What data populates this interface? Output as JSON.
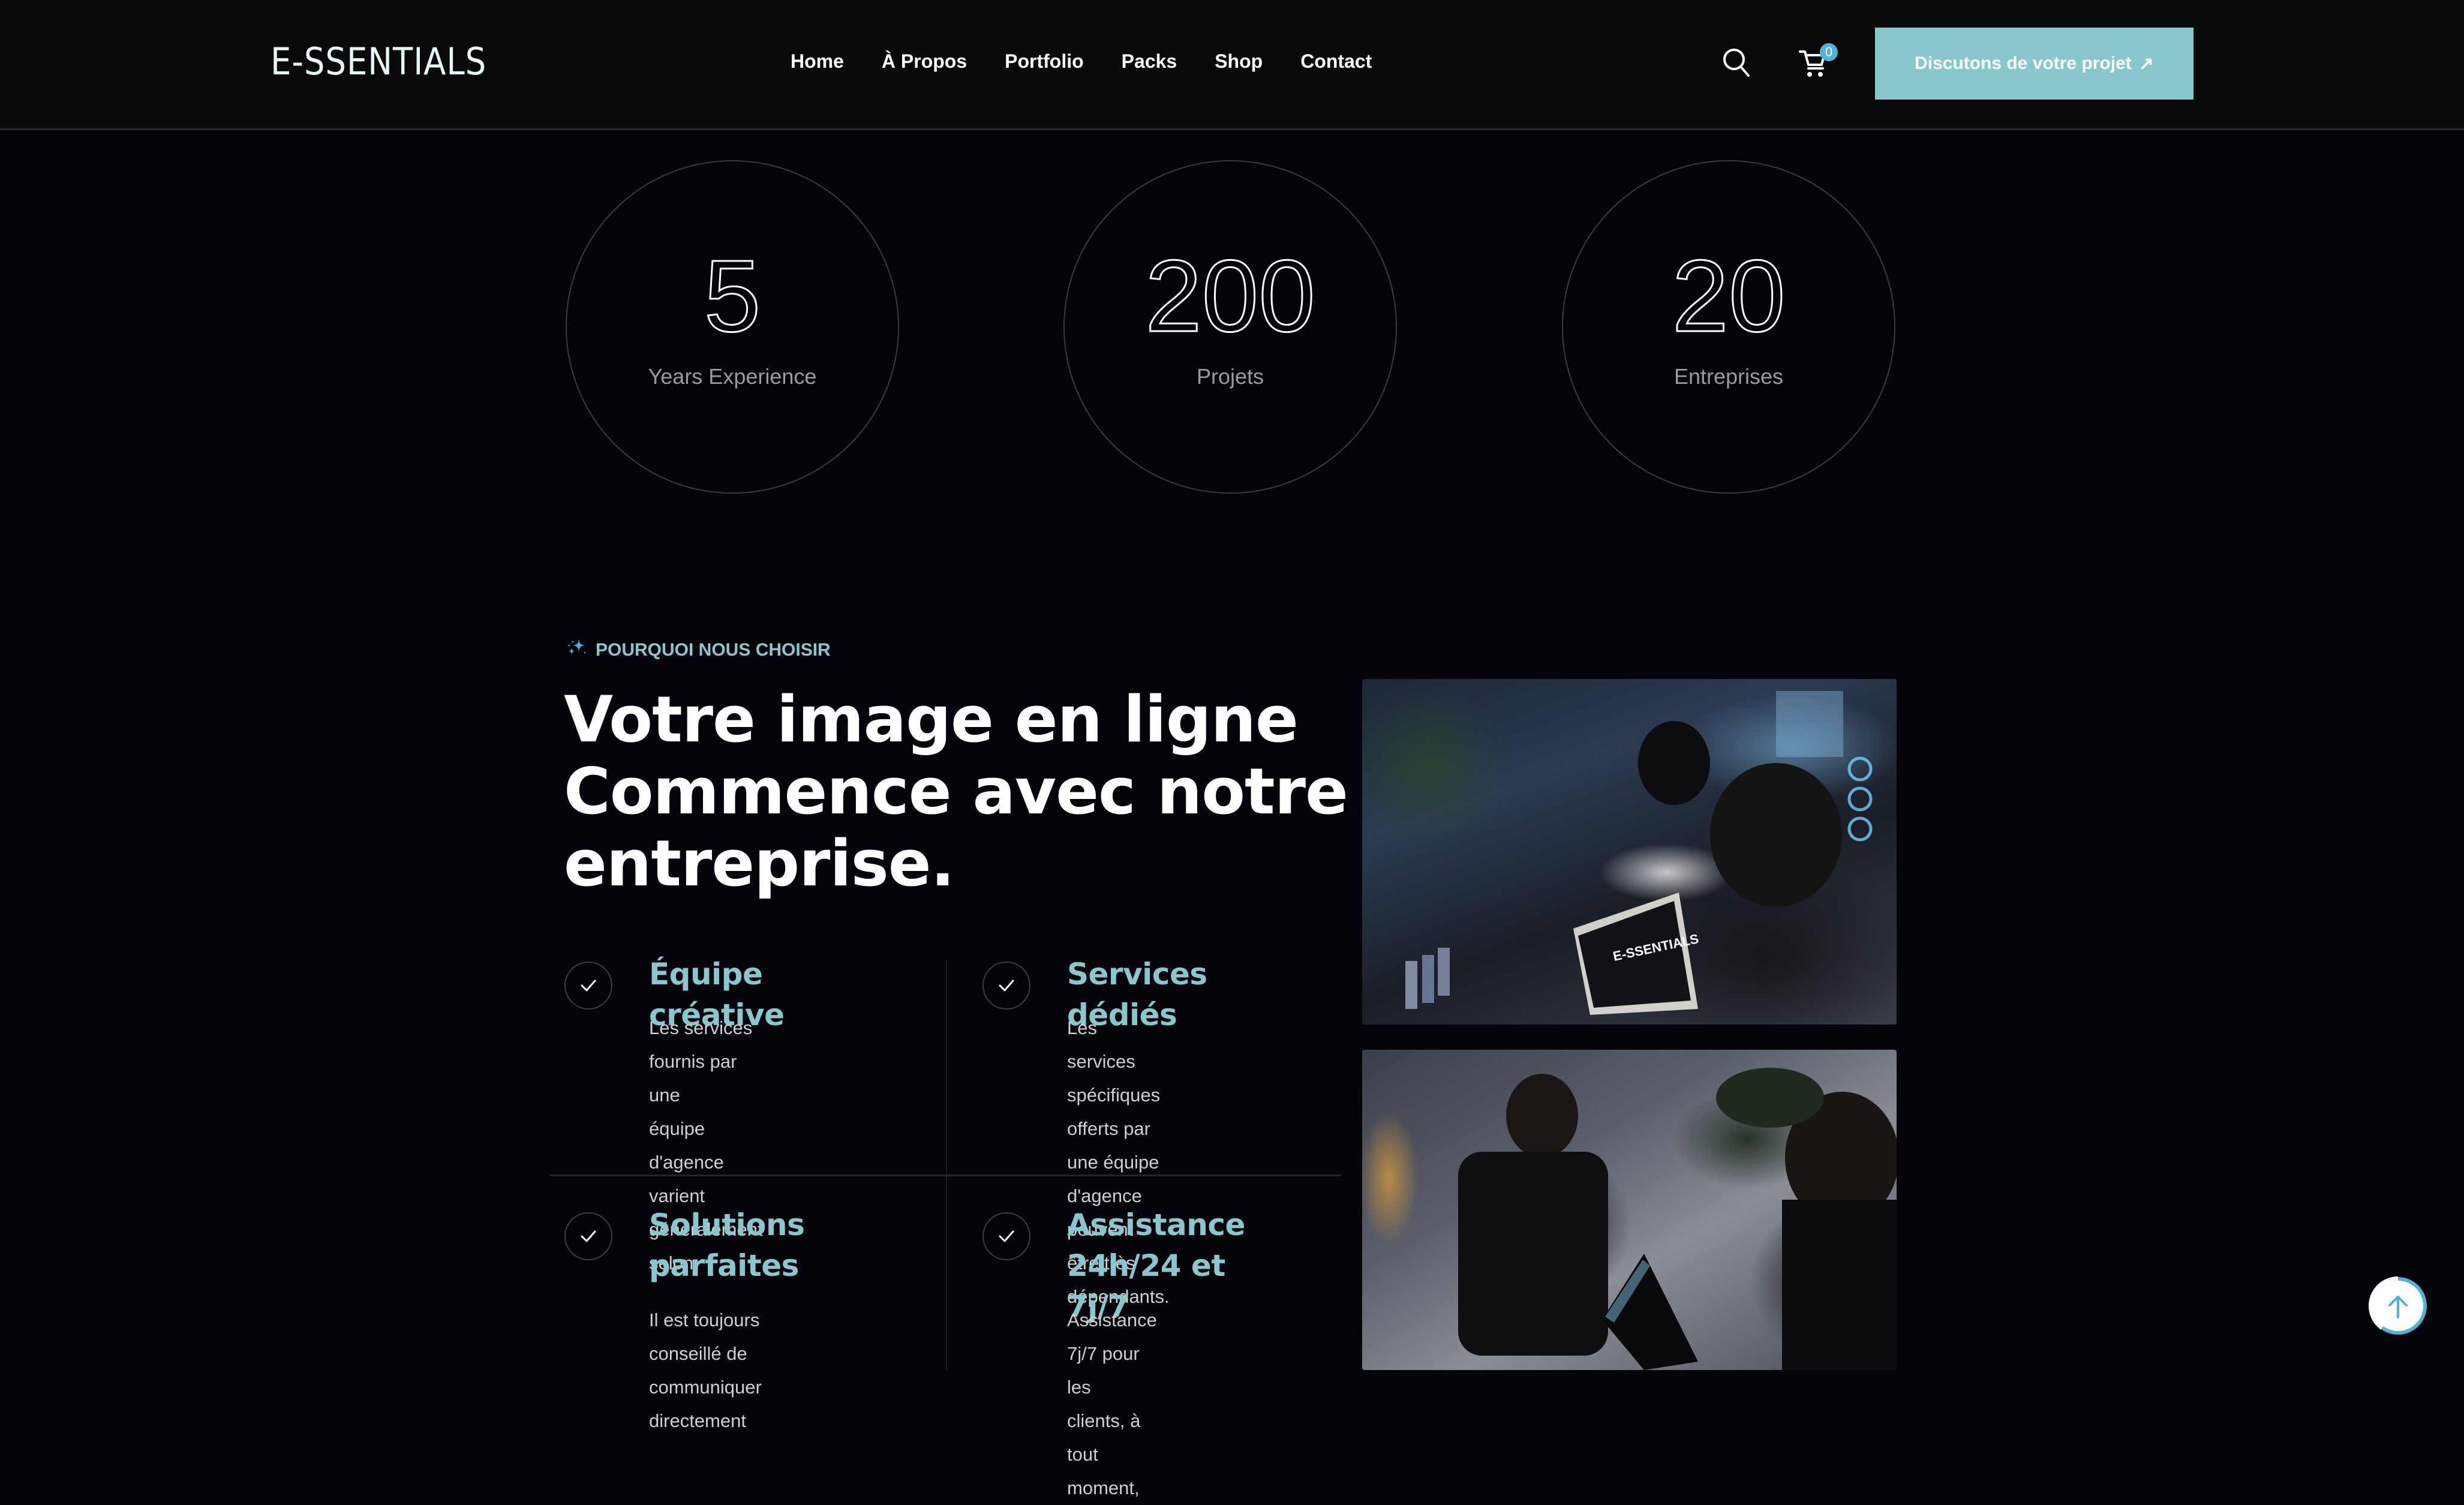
{
  "header": {
    "logo": "E-SSENTIALS",
    "nav": [
      "Home",
      "À Propos",
      "Portfolio",
      "Packs",
      "Shop",
      "Contact"
    ],
    "cart_count": "0",
    "cta_label": "Discutons de votre projet",
    "cta_icon": "↗"
  },
  "stats": [
    {
      "value": "5",
      "label": "Years Experience"
    },
    {
      "value": "200",
      "label": "Projets"
    },
    {
      "value": "20",
      "label": "Entreprises"
    }
  ],
  "why": {
    "tagline": "POURQUOI NOUS CHOISIR",
    "heading_lines": [
      "Votre image en ligne",
      "Commence avec notre",
      "entreprise."
    ],
    "features": [
      {
        "title_lines": [
          "Équipe créative"
        ],
        "desc_lines": [
          "Les services fournis par une",
          "équipe d'agence varient",
          "généralement selon."
        ]
      },
      {
        "title_lines": [
          "Services dédiés"
        ],
        "desc_lines": [
          "Les services spécifiques",
          "offerts par une équipe",
          "d'agence peuvent être très",
          "dépendants."
        ]
      },
      {
        "title_lines": [
          "Solutions",
          "parfaites"
        ],
        "desc_lines": [
          "Il est toujours conseillé de",
          "communiquer directement"
        ]
      },
      {
        "title_lines": [
          "Assistance",
          "24h/24 et 7j/7"
        ],
        "desc_lines": [
          "Assistance 7j/7 pour les",
          "clients, à tout moment,"
        ]
      }
    ]
  },
  "photos": [
    {
      "alt": "Équipe travaillant sur un ordinateur portable affichant E-SSENTIALS Votre Agence Marketing"
    },
    {
      "alt": "Deux membres de l'équipe travaillant sur des ordinateurs portables"
    }
  ],
  "scroll_top": {
    "progress": 0.6
  },
  "colors": {
    "accent": "#88c7cb",
    "badge": "#4fb2d9",
    "background": "#04040a",
    "header_bg": "#0a0a0b"
  }
}
